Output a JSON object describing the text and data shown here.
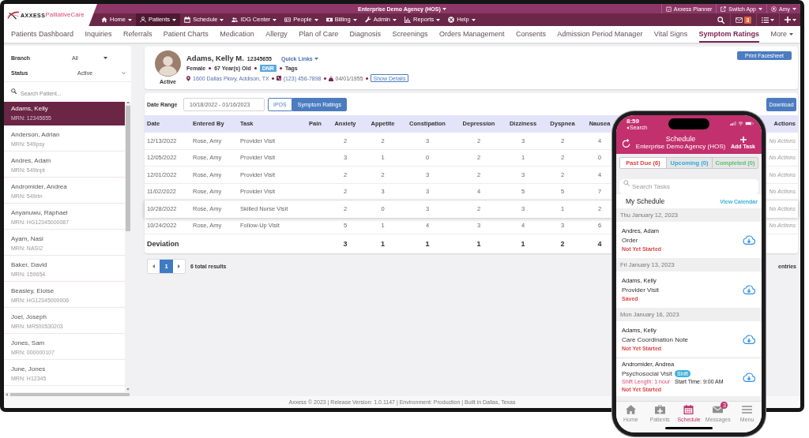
{
  "logo": {
    "brand": "AXXESS",
    "product": "PalliativeCare"
  },
  "top_bar": {
    "agency": "Enterprise Demo Agency (HOS)",
    "links": [
      {
        "label": "Axxess Planner",
        "has_menu": false
      },
      {
        "label": "Switch App",
        "has_menu": true
      },
      {
        "label": "Amy",
        "has_menu": true
      }
    ]
  },
  "main_nav": {
    "items": [
      {
        "label": "Home",
        "selected": false
      },
      {
        "label": "Patients",
        "selected": true
      },
      {
        "label": "Schedule",
        "selected": false
      },
      {
        "label": "IDG Center",
        "selected": false
      },
      {
        "label": "People",
        "selected": false
      },
      {
        "label": "Billing",
        "selected": false
      },
      {
        "label": "Admin",
        "selected": false
      },
      {
        "label": "Reports",
        "selected": false
      },
      {
        "label": "Help",
        "selected": false
      }
    ],
    "message_count": "3"
  },
  "tabs": [
    {
      "label": "Patients Dashboard",
      "selected": false,
      "has_menu": false
    },
    {
      "label": "Inquiries",
      "selected": false,
      "has_menu": false
    },
    {
      "label": "Referrals",
      "selected": false,
      "has_menu": false
    },
    {
      "label": "Patient Charts",
      "selected": false,
      "has_menu": false
    },
    {
      "label": "Medication",
      "selected": false,
      "has_menu": false
    },
    {
      "label": "Allergy",
      "selected": false,
      "has_menu": false
    },
    {
      "label": "Plan of Care",
      "selected": false,
      "has_menu": false
    },
    {
      "label": "Diagnosis",
      "selected": false,
      "has_menu": false
    },
    {
      "label": "Screenings",
      "selected": false,
      "has_menu": false
    },
    {
      "label": "Orders Management",
      "selected": false,
      "has_menu": false
    },
    {
      "label": "Consents",
      "selected": false,
      "has_menu": false
    },
    {
      "label": "Admission Period Manager",
      "selected": false,
      "has_menu": false
    },
    {
      "label": "Vital Signs",
      "selected": false,
      "has_menu": false
    },
    {
      "label": "Symptom Ratings",
      "selected": true,
      "has_menu": false
    },
    {
      "label": "More",
      "selected": false,
      "has_menu": true
    }
  ],
  "sidebar": {
    "filters": [
      {
        "label": "Branch",
        "value": "All"
      },
      {
        "label": "Status",
        "value": "Active"
      }
    ],
    "search": {
      "placeholder": "Search Patient..."
    },
    "patients": [
      {
        "name": "Adams, Kelly",
        "mrn": "MRN: 12345655",
        "selected": true
      },
      {
        "name": "Anderson, Adrian",
        "mrn": "MRN: 549psy",
        "selected": false
      },
      {
        "name": "Andres, Adam",
        "mrn": "MRN: 549inpt",
        "selected": false
      },
      {
        "name": "Andromider, Andrea",
        "mrn": "MRN: 549rtn",
        "selected": false
      },
      {
        "name": "Anyanuwu, Raphael",
        "mrn": "MRN: HG12345000087",
        "selected": false
      },
      {
        "name": "Ayam, Nasi",
        "mrn": "MRN: NASI2",
        "selected": false
      },
      {
        "name": "Baker, David",
        "mrn": "MRN: 159654",
        "selected": false
      },
      {
        "name": "Beasley, Eloise",
        "mrn": "MRN: HG12345000006",
        "selected": false
      },
      {
        "name": "Joel, Joseph",
        "mrn": "MRN: MR500530203",
        "selected": false
      },
      {
        "name": "Jones, Sam",
        "mrn": "MRN: 000000107",
        "selected": false
      },
      {
        "name": "June, Jones",
        "mrn": "MRN: H12345",
        "selected": false
      }
    ]
  },
  "patient": {
    "status": "Active",
    "name": "Adams, Kelly M.",
    "id": "12345655",
    "quick_links": "Quick Links",
    "gender": "Female",
    "age": "67 Year(s) Old",
    "code_status": "DNR",
    "tags": "Tags",
    "address": "1600 Dallas Pkwy, Addison, TX",
    "phone": "(123) 456-7898",
    "birth_date": "04/01/1955",
    "details_button": "Show Details",
    "print_button": "Print Facesheet"
  },
  "toolbar": {
    "date_range_label": "Date Range",
    "date_range": "10/18/2022 - 01/16/2023",
    "views": [
      {
        "label": "IPOS",
        "selected": false
      },
      {
        "label": "Symptom Ratings",
        "selected": true
      }
    ],
    "download_button": "Download"
  },
  "table": {
    "columns": [
      "Date",
      "Entered By",
      "Task",
      "Pain",
      "Anxiety",
      "Appetite",
      "Constipation",
      "Depression",
      "Dizziness",
      "Dyspnea",
      "Nausea",
      "Actions"
    ],
    "rows": [
      {
        "date": "12/13/2022",
        "entered_by": "Rose, Amy",
        "task": "Provider Visit",
        "scores": [
          "2",
          "2",
          "3",
          "2",
          "3",
          "2",
          "4"
        ],
        "actions": "No Actions",
        "highlighted": false
      },
      {
        "date": "12/05/2022",
        "entered_by": "Rose, Amy",
        "task": "Provider Visit",
        "scores": [
          "3",
          "1",
          "0",
          "2",
          "1",
          "2",
          "0"
        ],
        "actions": "No Actions",
        "highlighted": false
      },
      {
        "date": "12/01/2022",
        "entered_by": "Rose, Amy",
        "task": "Provider Visit",
        "scores": [
          "2",
          "2",
          "3",
          "2",
          "3",
          "2",
          "4"
        ],
        "actions": "No Actions",
        "highlighted": false
      },
      {
        "date": "11/02/2022",
        "entered_by": "Rose, Amy",
        "task": "Provider Visit",
        "scores": [
          "2",
          "3",
          "3",
          "4",
          "5",
          "5",
          "7"
        ],
        "actions": "No Actions",
        "highlighted": false
      },
      {
        "date": "10/28/2022",
        "entered_by": "Rose, Amy",
        "task": "Skilled Nurse Visit",
        "scores": [
          "2",
          "0",
          "3",
          "2",
          "3",
          "1",
          "2"
        ],
        "actions": "No Actions",
        "highlighted": true
      },
      {
        "date": "10/24/2022",
        "entered_by": "Rose, Amy",
        "task": "Follow-Up Visit",
        "scores": [
          "5",
          "1",
          "4",
          "3",
          "4",
          "3",
          "6"
        ],
        "actions": "No Actions",
        "highlighted": false
      }
    ],
    "deviation": {
      "label": "Deviation",
      "values": [
        "3",
        "1",
        "1",
        "1",
        "1",
        "2",
        "4"
      ]
    }
  },
  "pagination": {
    "pages": [
      {
        "label": "1",
        "selected": true
      }
    ],
    "summary": "6 total results",
    "page_size_suffix": "entries"
  },
  "footer": "Axxess © 2023 | Release Version: 1.0.1147 | Environment: Production | Built in Dallas, Texas",
  "phone": {
    "time": "8:59",
    "back_label": "Search",
    "title": "Schedule",
    "subtitle": "Enterprise Demo Agency (HOS)",
    "add_button": "Add Task",
    "segments": [
      {
        "label": "Past Due (6)",
        "selected": true,
        "color": "#e2403f"
      },
      {
        "label": "Upcoming (0)",
        "selected": false,
        "color": "#2fa8d6"
      },
      {
        "label": "Completed (0)",
        "selected": false,
        "color": "#5dbf6b"
      }
    ],
    "search": {
      "placeholder": "Search Tasks"
    },
    "section_title": "My Schedule",
    "calendar_link": "View Calendar",
    "days": [
      {
        "date": "Thu January 12, 2023",
        "tasks": [
          {
            "patient": "Andres, Adam",
            "task": "Order",
            "status": "Not Yet Started"
          }
        ]
      },
      {
        "date": "Fri January 13, 2023",
        "tasks": [
          {
            "patient": "Adams, Kelly",
            "task": "Provider Visit",
            "status": "Saved"
          }
        ]
      },
      {
        "date": "Mon January 16, 2023",
        "tasks": [
          {
            "patient": "Adams, Kelly",
            "task": "Care Coordination Note",
            "status": "Not Yet Started"
          },
          {
            "patient": "Andromider, Andrea",
            "task": "Psychosocial Visit",
            "tag": "Shift",
            "shift_length": "Shift Length: 1 hour",
            "start_time": "Start Time: 9:00 AM",
            "status": "Not Yet Started"
          }
        ]
      }
    ],
    "tab_bar": [
      {
        "label": "Home",
        "selected": false
      },
      {
        "label": "Patients",
        "selected": false
      },
      {
        "label": "Schedule",
        "selected": true
      },
      {
        "label": "Messages",
        "selected": false,
        "badge": "3"
      },
      {
        "label": "Menu",
        "selected": false
      }
    ]
  }
}
